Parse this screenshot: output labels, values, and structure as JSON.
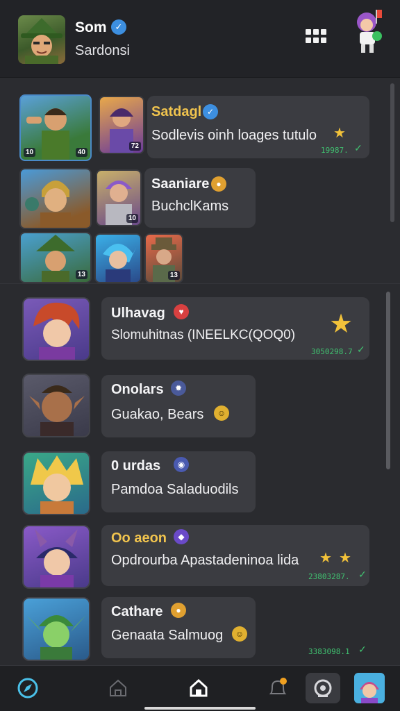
{
  "header": {
    "name": "Som",
    "subtitle": "Sardonsi"
  },
  "chats_top": [
    {
      "name": "Satdagl",
      "message": "Sodlevis oinh loages tutulo",
      "time": "19987.",
      "thumb_badge": "72"
    },
    {
      "name": "Saaniare",
      "message": "BuchclKams",
      "thumb_badge": "10"
    }
  ],
  "thumb_badges": {
    "t1": "10",
    "t2": "40",
    "t3": "72",
    "t4": "10",
    "t5": "13",
    "t6": "13",
    "t7": "10",
    "t8": "13"
  },
  "chats": [
    {
      "name": "Ulhavag",
      "message": "Slomuhitnas (INEELKC(QOQ0)",
      "time": "3050298.7"
    },
    {
      "name": "Onolars",
      "message": "Guakao, Bears"
    },
    {
      "name": "0 urdas",
      "message": "Pamdoa Saladuodils"
    },
    {
      "name": "Oo aeon",
      "message": "Opdrourba Apastadeninoa lida",
      "time": "23803287."
    },
    {
      "name": "Cathare",
      "message": "Genaata Salmuog",
      "time": "3383098.1"
    }
  ],
  "colors": {
    "background": "#2b2c30",
    "bubble": "#3b3c41",
    "time_green": "#40c070",
    "verified_blue": "#3d8fe0",
    "gold": "#f1c44e"
  },
  "icons": {
    "nav": [
      "compass-icon",
      "home-outline-icon",
      "home-icon",
      "bell-icon",
      "camera-icon",
      "profile-avatar"
    ]
  }
}
